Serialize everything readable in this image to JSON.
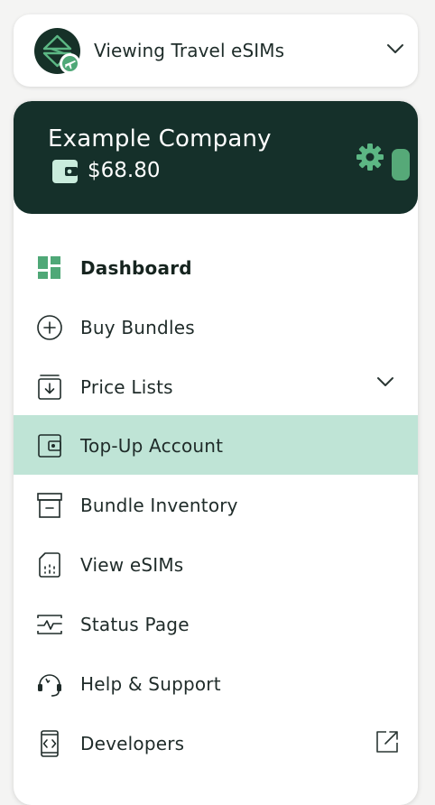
{
  "switcher": {
    "label": "Viewing Travel eSIMs",
    "logo_icon": "company-logo-icon",
    "badge_icon": "airplane-icon",
    "chevron_icon": "chevron-down-icon"
  },
  "account": {
    "company": "Example Company",
    "balance": "$68.80",
    "wallet_icon": "wallet-icon",
    "settings_icon": "gear-icon"
  },
  "menu": {
    "items": [
      {
        "label": "Dashboard",
        "icon": "dashboard-icon",
        "active_indicator": true
      },
      {
        "label": "Buy Bundles",
        "icon": "plus-circle-icon"
      },
      {
        "label": "Price Lists",
        "icon": "download-tray-icon",
        "trailing": "chevron-down-icon"
      },
      {
        "label": "Top-Up Account",
        "icon": "wallet-icon",
        "selected": true
      },
      {
        "label": "Bundle Inventory",
        "icon": "archive-box-icon"
      },
      {
        "label": "View eSIMs",
        "icon": "sim-card-icon"
      },
      {
        "label": "Status Page",
        "icon": "pulse-monitor-icon"
      },
      {
        "label": "Help & Support",
        "icon": "headset-icon"
      },
      {
        "label": "Developers",
        "icon": "code-device-icon",
        "trailing": "external-link-icon"
      }
    ]
  },
  "colors": {
    "brand_dark": "#15302a",
    "brand_green": "#56a978",
    "selected_bg": "#bfe4d6"
  }
}
